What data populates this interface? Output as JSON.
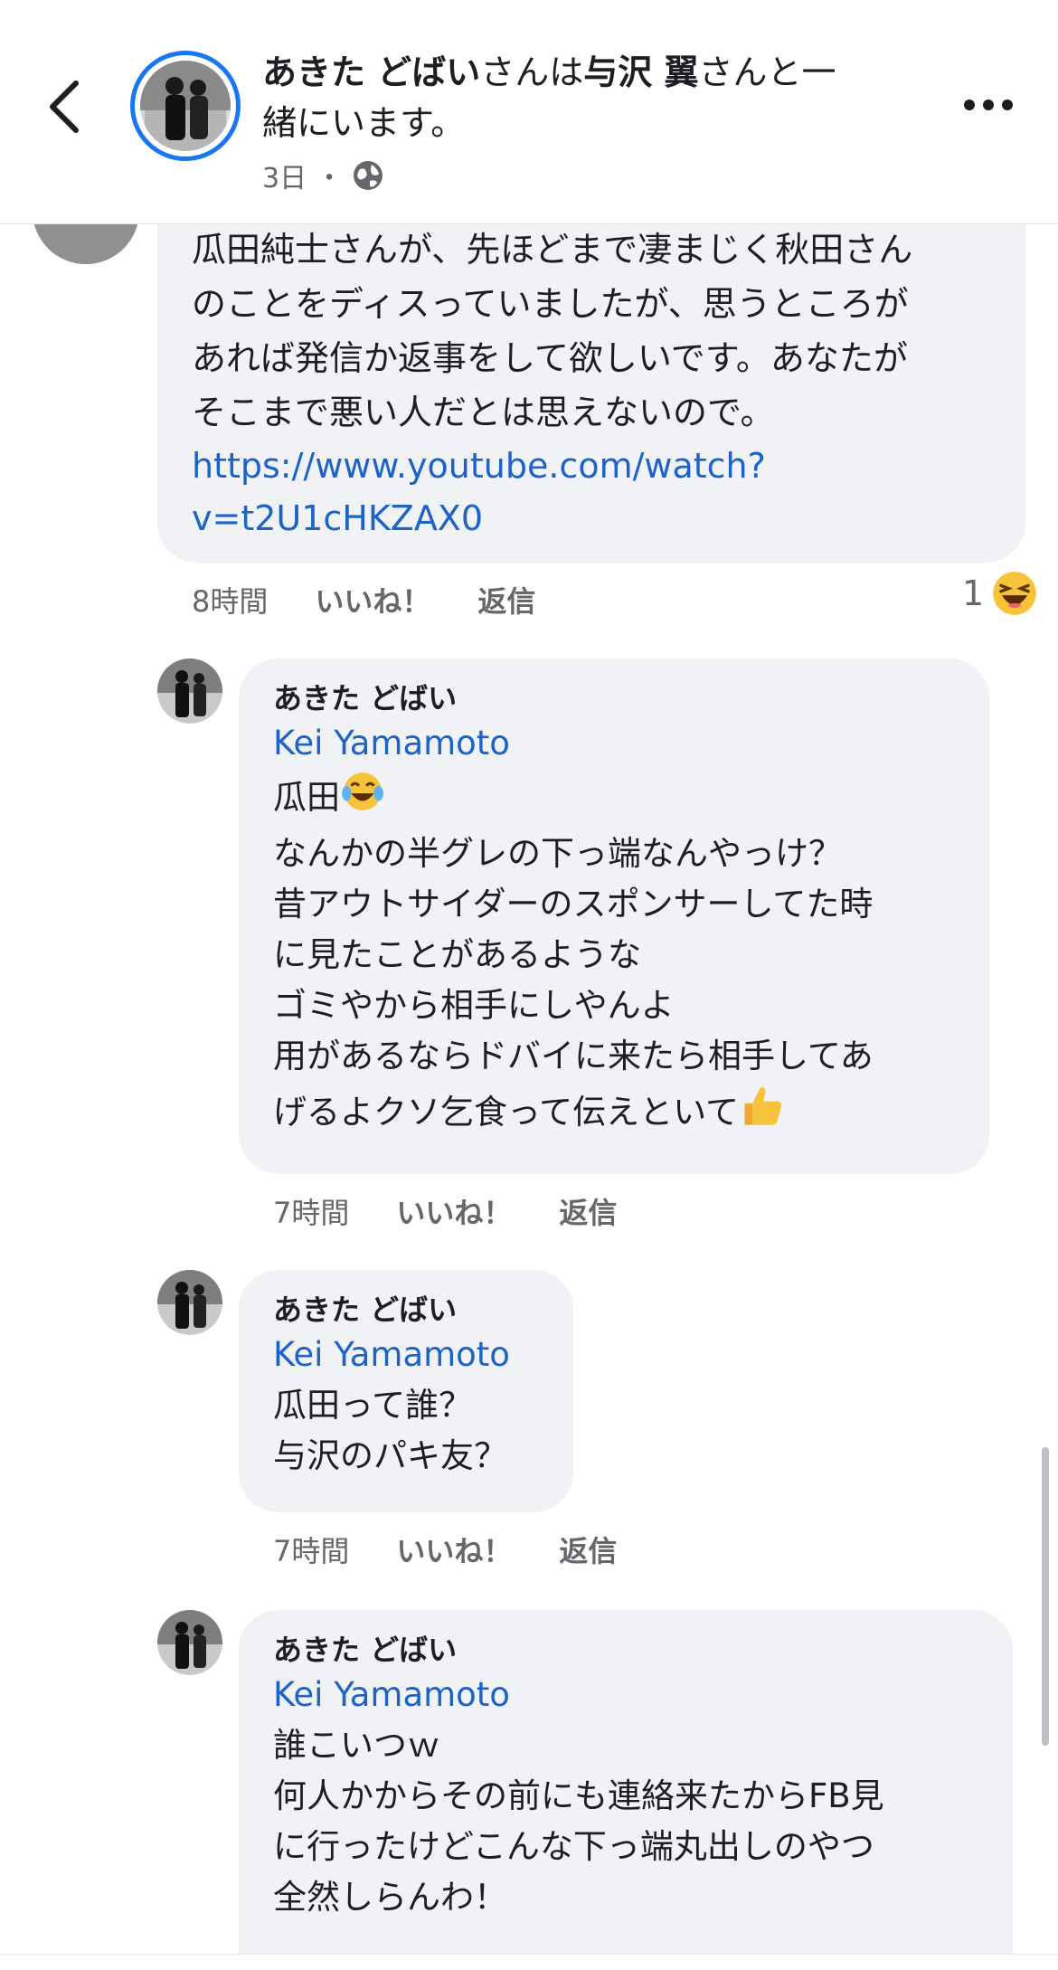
{
  "header": {
    "title_author": "あきた どばい",
    "title_mid": "さんは",
    "title_tagged": "与沢 翼",
    "title_tail_line1": "さんと一",
    "title_line2": "緒にいます。",
    "time": "3日",
    "separator": "・",
    "privacy_icon": "globe-icon",
    "back_icon": "chevron-left-icon",
    "more_icon": "more-horizontal-icon"
  },
  "top_comment": {
    "lines": [
      "瓜田純士さんが、先ほどまで凄まじく秋田さん",
      "のことをディスっていましたが、思うところが",
      "あれば発信か返事をして欲しいです。あなたが",
      "そこまで悪い人だとは思えないので。"
    ],
    "link_line1": "https://www.youtube.com/watch?",
    "link_line2": "v=t2U1cHKZAX0",
    "time": "8時間",
    "like": "いいね！",
    "reply": "返信",
    "reaction_count": "1",
    "reaction_icon": "haha-reaction-icon"
  },
  "replies": [
    {
      "author": "あきた どばい",
      "mention": "Kei Yamamoto",
      "lines": [
        "瓜田",
        "なんかの半グレの下っ端なんやっけ？",
        "昔アウトサイダーのスポンサーしてた時",
        "に見たことがあるような",
        "ゴミやから相手にしやんよ",
        "用があるならドバイに来たら相手してあ",
        "げるよクソ乞食って伝えといて"
      ],
      "time": "7時間",
      "like": "いいね！",
      "reply": "返信"
    },
    {
      "author": "あきた どばい",
      "mention": "Kei Yamamoto",
      "lines": [
        "瓜田って誰？",
        "与沢のパキ友？"
      ],
      "time": "7時間",
      "like": "いいね！",
      "reply": "返信"
    },
    {
      "author": "あきた どばい",
      "mention": "Kei Yamamoto",
      "lines": [
        "誰こいつｗ",
        "何人かからその前にも連絡来たからFB見",
        "に行ったけどこんな下っ端丸出しのやつ",
        "全然しらんわ！"
      ]
    }
  ],
  "colors": {
    "link": "#1b63c9",
    "bubble": "#f0f2f5",
    "meta": "#65676b",
    "avatar_ring": "#1877f2"
  }
}
